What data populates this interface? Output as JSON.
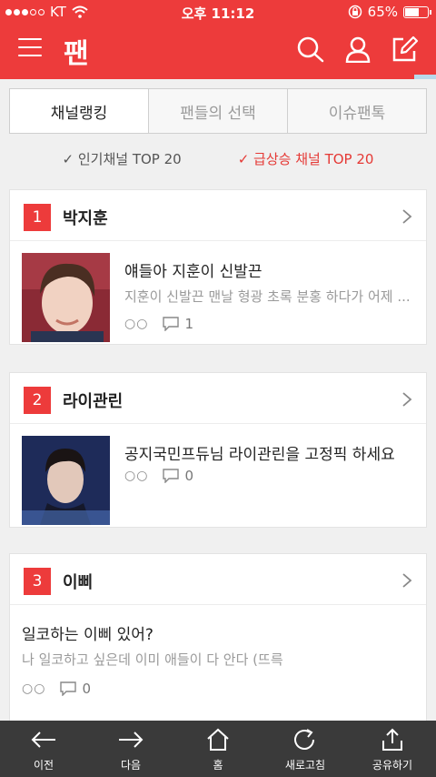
{
  "status_bar": {
    "carrier": "KT",
    "time": "오후 11:12",
    "battery": "65%",
    "battery_level": 0.65
  },
  "app": {
    "logo": "팬"
  },
  "tabs": [
    {
      "label": "채널랭킹",
      "active": true
    },
    {
      "label": "팬들의 선택",
      "active": false
    },
    {
      "label": "이슈팬톡",
      "active": false
    }
  ],
  "filters": [
    {
      "label": "✓ 인기채널 TOP 20",
      "active": false
    },
    {
      "label": "✓ 급상승 채널 TOP 20",
      "active": true
    }
  ],
  "channels": [
    {
      "rank": "1",
      "name": "박지훈",
      "post_title": "얘들아 지훈이 신발끈",
      "post_desc": "지훈이 신발끈 맨날 형광 초록 분홍 하다가 어제 ...",
      "views": "○○",
      "comments": "1"
    },
    {
      "rank": "2",
      "name": "라이관린",
      "post_title": "공지국민프듀님 라이관린을 고정픽 하세요",
      "post_desc": "",
      "views": "○○",
      "comments": "0"
    },
    {
      "rank": "3",
      "name": "이삐",
      "post_title": "일코하는 이삐 있어?",
      "post_desc": "나 일코하고 싶은데 이미 애들이 다 안다 (뜨륵",
      "views": "○○",
      "comments": "0"
    }
  ],
  "bottom_nav": [
    {
      "label": "이전",
      "icon": "arrow-left-icon"
    },
    {
      "label": "다음",
      "icon": "arrow-right-icon"
    },
    {
      "label": "홈",
      "icon": "home-icon"
    },
    {
      "label": "새로고침",
      "icon": "refresh-icon"
    },
    {
      "label": "공유하기",
      "icon": "share-icon"
    }
  ],
  "colors": {
    "brand": "#ed3b3b",
    "bottom_bar": "#3a3a3a"
  }
}
